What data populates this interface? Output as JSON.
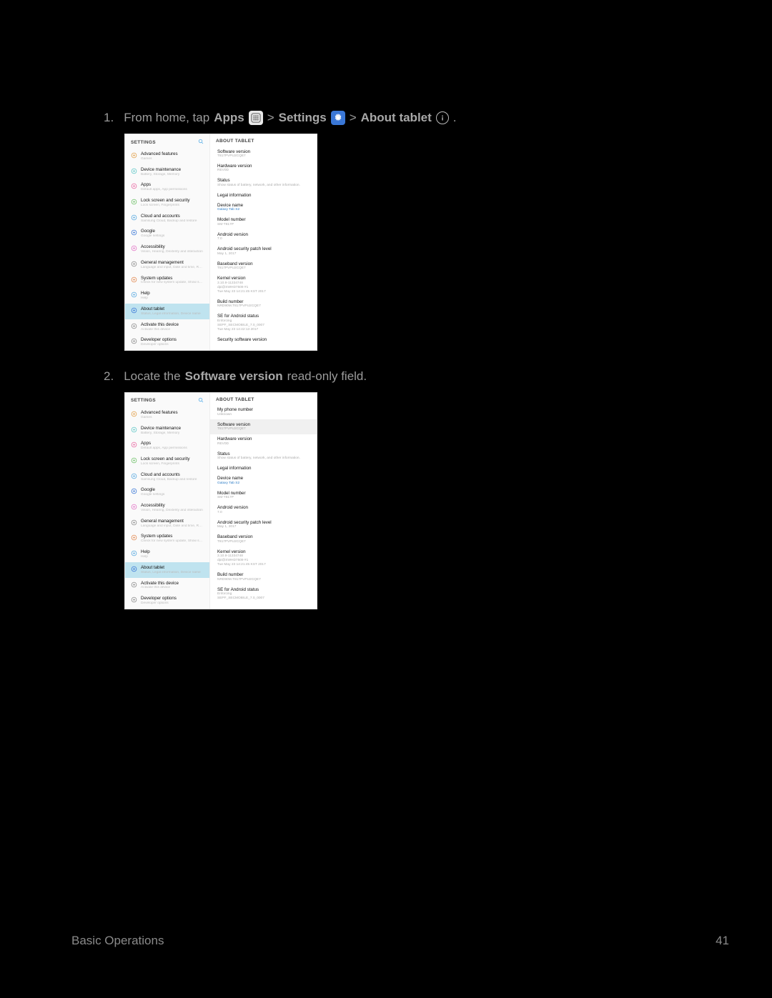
{
  "step1": {
    "num": "1.",
    "t1": "From home, tap ",
    "apps": "Apps",
    "gt1": " > ",
    "settings": "Settings",
    "gt2": " > ",
    "about": "About tablet",
    "dot": "."
  },
  "step2": {
    "num": "2.",
    "t1": "Locate the ",
    "sw": "Software version",
    "t2": " read-only field."
  },
  "settingsPane": {
    "header": "SETTINGS",
    "items": [
      {
        "title": "Advanced features",
        "sub": "Games",
        "color": "#e2a04a"
      },
      {
        "title": "Device maintenance",
        "sub": "Battery, Storage, Memory",
        "color": "#5fc7c7"
      },
      {
        "title": "Apps",
        "sub": "Default apps, App permissions",
        "color": "#e96aa3"
      },
      {
        "title": "Lock screen and security",
        "sub": "Lock screen, Fingerprints",
        "color": "#6fc168"
      },
      {
        "title": "Cloud and accounts",
        "sub": "Samsung Cloud, Backup and restore",
        "color": "#58a9e0"
      },
      {
        "title": "Google",
        "sub": "Google settings",
        "color": "#3a77d6"
      },
      {
        "title": "Accessibility",
        "sub": "Vision, Hearing, Dexterity and interaction",
        "color": "#e273c6"
      },
      {
        "title": "General management",
        "sub": "Language and input, Date and time, Res…",
        "color": "#8b8b8b"
      },
      {
        "title": "System updates",
        "sub": "Check for new system update, Show sy…",
        "color": "#e28950"
      },
      {
        "title": "Help",
        "sub": "Help",
        "color": "#58a9e0"
      },
      {
        "title": "About tablet",
        "sub": "Status, Legal information, Device name",
        "color": "#3a77d6"
      },
      {
        "title": "Activate this device",
        "sub": "Activate this device",
        "color": "#8b8b8b"
      },
      {
        "title": "Developer options",
        "sub": "Developer options",
        "color": "#8b8b8b"
      }
    ],
    "selectedIndex": 10
  },
  "aboutPane1": {
    "header": "ABOUT TABLET",
    "items": [
      {
        "title": "Software version",
        "sub": "T817PVPU2CQE7"
      },
      {
        "title": "Hardware version",
        "sub": "REV0D"
      },
      {
        "title": "Status",
        "sub": "Show status of battery, network, and other information."
      },
      {
        "title": "Legal information",
        "sub": ""
      },
      {
        "title": "Device name",
        "sub": "Galaxy Tab S2",
        "link": true
      },
      {
        "title": "Model number",
        "sub": "SM-T817P"
      },
      {
        "title": "Android version",
        "sub": "7.0"
      },
      {
        "title": "Android security patch level",
        "sub": "May 1, 2017"
      },
      {
        "title": "Baseband version",
        "sub": "T817PVPU2CQE7"
      },
      {
        "title": "Kernel version",
        "sub": "3.10.9-11334748\ndpi@SWHD7509 #1\nTue May 23 14:21:45 KST 2017"
      },
      {
        "title": "Build number",
        "sub": "NRD90M.T817PVPU2CQE7"
      },
      {
        "title": "SE for Android status",
        "sub": "Enforcing\nSEPF_SECMOBILE_7.0_0007\nTue May 23 14:42:13 2017"
      },
      {
        "title": "Security software version",
        "sub": ""
      }
    ]
  },
  "aboutPane2": {
    "header": "ABOUT TABLET",
    "items": [
      {
        "title": "My phone number",
        "sub": "Unknown"
      },
      {
        "title": "Software version",
        "sub": "T817PVPU2CQE7",
        "hl": true
      },
      {
        "title": "Hardware version",
        "sub": "REV0D"
      },
      {
        "title": "Status",
        "sub": "Show status of battery, network, and other information."
      },
      {
        "title": "Legal information",
        "sub": ""
      },
      {
        "title": "Device name",
        "sub": "Galaxy Tab S2",
        "link": true
      },
      {
        "title": "Model number",
        "sub": "SM-T817P"
      },
      {
        "title": "Android version",
        "sub": "7.0"
      },
      {
        "title": "Android security patch level",
        "sub": "May 1, 2017"
      },
      {
        "title": "Baseband version",
        "sub": "T817PVPU2CQE7"
      },
      {
        "title": "Kernel version",
        "sub": "3.10.9-11334748\ndpi@SWHD7509 #1\nTue May 23 14:21:45 KST 2017"
      },
      {
        "title": "Build number",
        "sub": "NRD90M.T817PVPU2CQE7"
      },
      {
        "title": "SE for Android status",
        "sub": "Enforcing\nSEPF_SECMOBILE_7.0_0007"
      }
    ]
  },
  "footer": {
    "left": "Basic Operations",
    "right": "41"
  }
}
